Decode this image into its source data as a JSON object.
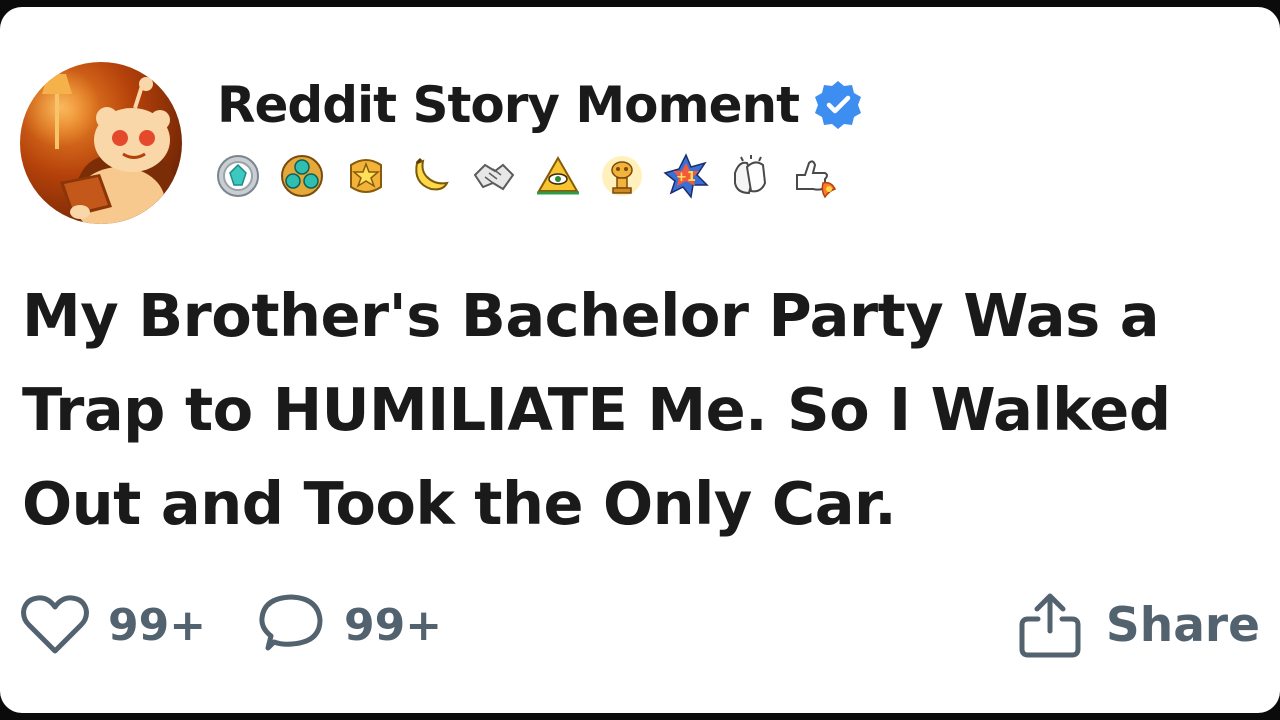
{
  "post": {
    "author": "Reddit Story Moment",
    "verified": true,
    "title": "My Brother's Bachelor Party Was a Trap to HUMILIATE Me. So I Walked Out and Took the Only Car."
  },
  "badges": [
    {
      "name": "gem-award"
    },
    {
      "name": "triple-gem-award"
    },
    {
      "name": "star-award"
    },
    {
      "name": "banana-award"
    },
    {
      "name": "handshake-award"
    },
    {
      "name": "pyramid-eye-award"
    },
    {
      "name": "snoo-trophy-award"
    },
    {
      "name": "plus-one-award"
    },
    {
      "name": "clapping-hands-award"
    },
    {
      "name": "rocket-thumbs-up-award"
    }
  ],
  "actions": {
    "like_count": "99+",
    "comment_count": "99+",
    "share_label": "Share"
  },
  "colors": {
    "text": "#1a1a1b",
    "muted": "#53626f",
    "verified": "#3d8ef0",
    "avatar": "#b4410a"
  }
}
